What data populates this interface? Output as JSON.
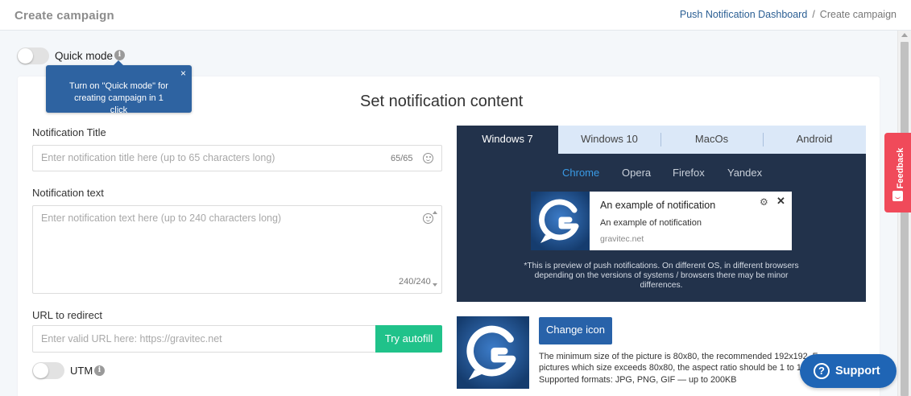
{
  "header": {
    "title": "Create campaign",
    "breadcrumb": {
      "link": "Push Notification Dashboard",
      "separator": "/",
      "current": "Create campaign"
    }
  },
  "quick_mode": {
    "label": "Quick mode",
    "enabled": false,
    "tooltip": "Turn on \"Quick mode\" for creating campaign in 1 click"
  },
  "main": {
    "section_title": "Set notification content",
    "notification_title": {
      "label": "Notification Title",
      "placeholder": "Enter notification title here (up to 65 characters long)",
      "counter": "65/65"
    },
    "notification_text": {
      "label": "Notification text",
      "placeholder": "Enter notification text here (up to 240 characters long)",
      "counter": "240/240"
    },
    "url": {
      "label": "URL to redirect",
      "placeholder": "Enter valid URL here: https://gravitec.net",
      "autofill_button": "Try autofill"
    },
    "utm": {
      "label": "UTM",
      "enabled": false
    }
  },
  "preview": {
    "os_tabs": [
      "Windows 7",
      "Windows 10",
      "MacOs",
      "Android"
    ],
    "active_os": "Windows 7",
    "browser_tabs": [
      "Chrome",
      "Opera",
      "Firefox",
      "Yandex"
    ],
    "active_browser": "Chrome",
    "notification": {
      "title": "An example of notification",
      "text": "An example of notification",
      "site": "gravitec.net"
    },
    "note": "*This is preview of push notifications. On different OS, in different browsers depending on the versions of systems / browsers there may be minor differences."
  },
  "icon_section": {
    "change_button": "Change icon",
    "description": "The minimum size of the picture is 80x80, the recommended 192x192. For pictures which size exceeds 80x80, the aspect ratio should be 1 to 1. Supported formats: JPG, PNG, GIF — up to 200KB"
  },
  "feedback": {
    "label": "Feedback"
  },
  "support": {
    "label": "Support",
    "icon": "?"
  },
  "colors": {
    "accent": "#2862a9",
    "preview_bg": "#22324b",
    "autofill_green": "#20c28a",
    "feedback_red": "#f04a5a",
    "support_blue": "#1f65b5"
  }
}
